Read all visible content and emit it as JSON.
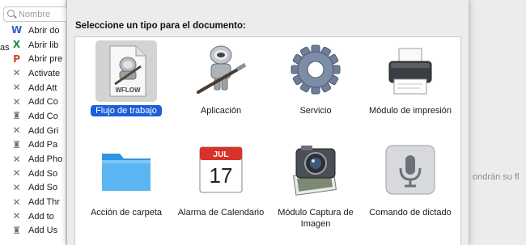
{
  "search": {
    "placeholder": "Nombre"
  },
  "library": {
    "category_fragment": "as",
    "items": [
      {
        "label": "Abrir do",
        "icon": "word-icon",
        "color": "#2a63c8",
        "glyph": "W"
      },
      {
        "label": "Abrir lib",
        "icon": "excel-icon",
        "color": "#1e8a3c",
        "glyph": "X"
      },
      {
        "label": "Abrir pre",
        "icon": "powerpoint-icon",
        "color": "#d8442a",
        "glyph": "P"
      },
      {
        "label": "Activate",
        "icon": "automator-tools-icon",
        "color": "#6d6d6d",
        "glyph": "✕"
      },
      {
        "label": "Add Att",
        "icon": "automator-tools-icon",
        "color": "#6d6d6d",
        "glyph": "✕"
      },
      {
        "label": "Add Co",
        "icon": "automator-tools-icon",
        "color": "#6d6d6d",
        "glyph": "✕"
      },
      {
        "label": "Add Co",
        "icon": "automator-robot-icon",
        "color": "#6d6d6d",
        "glyph": "♜"
      },
      {
        "label": "Add Gri",
        "icon": "automator-tools-icon",
        "color": "#6d6d6d",
        "glyph": "✕"
      },
      {
        "label": "Add Pa",
        "icon": "automator-robot-icon",
        "color": "#6d6d6d",
        "glyph": "♜"
      },
      {
        "label": "Add Pho",
        "icon": "automator-tools-icon",
        "color": "#6d6d6d",
        "glyph": "✕"
      },
      {
        "label": "Add So",
        "icon": "automator-tools-icon",
        "color": "#6d6d6d",
        "glyph": "✕"
      },
      {
        "label": "Add So",
        "icon": "automator-tools-icon",
        "color": "#6d6d6d",
        "glyph": "✕"
      },
      {
        "label": "Add Thr",
        "icon": "automator-tools-icon",
        "color": "#6d6d6d",
        "glyph": "✕"
      },
      {
        "label": "Add to",
        "icon": "automator-tools-icon",
        "color": "#6d6d6d",
        "glyph": "✕"
      },
      {
        "label": "Add Us",
        "icon": "automator-robot-icon",
        "color": "#6d6d6d",
        "glyph": "♜"
      }
    ]
  },
  "background_right_text": "ondrán su fl",
  "sheet": {
    "title": "Seleccione un tipo para el documento:",
    "types": [
      {
        "label": "Flujo de trabajo",
        "icon": "workflow-document-icon",
        "file_ext": "WFLOW",
        "selected": true
      },
      {
        "label": "Aplicación",
        "icon": "automator-robot-icon",
        "selected": false
      },
      {
        "label": "Servicio",
        "icon": "gear-icon",
        "selected": false
      },
      {
        "label": "Módulo de impresión",
        "icon": "printer-icon",
        "selected": false
      },
      {
        "label": "Acción de carpeta",
        "icon": "folder-icon",
        "selected": false
      },
      {
        "label": "Alarma de Calendario",
        "icon": "calendar-icon",
        "calendar_month": "JUL",
        "calendar_day": "17",
        "selected": false
      },
      {
        "label": "Módulo Captura de Imagen",
        "icon": "image-capture-icon",
        "selected": false
      },
      {
        "label": "Comando de dictado",
        "icon": "microphone-icon",
        "selected": false
      }
    ]
  },
  "colors": {
    "selection": "#1d5ed9",
    "folder": "#3fa6ef",
    "calendar_red": "#d8322b"
  }
}
